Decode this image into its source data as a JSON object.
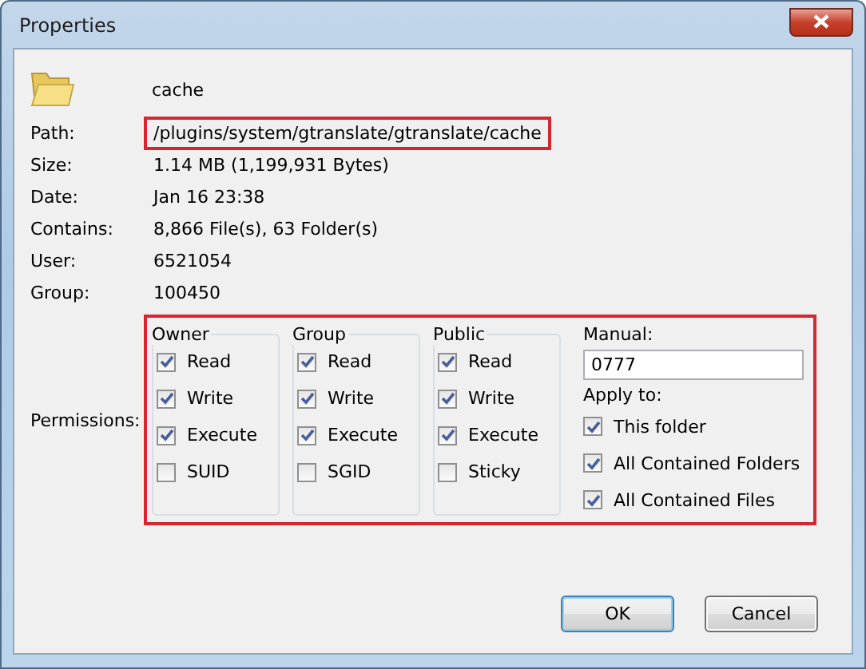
{
  "window": {
    "title": "Properties"
  },
  "name": "cache",
  "properties": [
    {
      "label": "Path:",
      "value": "/plugins/system/gtranslate/gtranslate/cache",
      "highlighted": true
    },
    {
      "label": "Size:",
      "value": "1.14 MB  (1,199,931 Bytes)",
      "highlighted": false
    },
    {
      "label": "Date:",
      "value": "Jan 16 23:38",
      "highlighted": false
    },
    {
      "label": "Contains:",
      "value": "8,866 File(s), 63 Folder(s)",
      "highlighted": false
    },
    {
      "label": "User:",
      "value": "6521054",
      "highlighted": false
    },
    {
      "label": "Group:",
      "value": "100450",
      "highlighted": false
    }
  ],
  "permissions": {
    "label": "Permissions:",
    "highlighted": true,
    "groups": [
      {
        "title": "Owner",
        "options": [
          {
            "label": "Read",
            "checked": true
          },
          {
            "label": "Write",
            "checked": true
          },
          {
            "label": "Execute",
            "checked": true
          },
          {
            "label": "SUID",
            "checked": false
          }
        ]
      },
      {
        "title": "Group",
        "options": [
          {
            "label": "Read",
            "checked": true
          },
          {
            "label": "Write",
            "checked": true
          },
          {
            "label": "Execute",
            "checked": true
          },
          {
            "label": "SGID",
            "checked": false
          }
        ]
      },
      {
        "title": "Public",
        "options": [
          {
            "label": "Read",
            "checked": true
          },
          {
            "label": "Write",
            "checked": true
          },
          {
            "label": "Execute",
            "checked": true
          },
          {
            "label": "Sticky",
            "checked": false
          }
        ]
      }
    ],
    "manual": {
      "label": "Manual:",
      "value": "0777"
    },
    "apply_to": {
      "label": "Apply to:",
      "options": [
        {
          "label": "This folder",
          "checked": true
        },
        {
          "label": "All Contained Folders",
          "checked": true
        },
        {
          "label": "All Contained Files",
          "checked": true
        }
      ]
    }
  },
  "buttons": [
    {
      "label": "OK",
      "default": true
    },
    {
      "label": "Cancel",
      "default": false
    }
  ]
}
